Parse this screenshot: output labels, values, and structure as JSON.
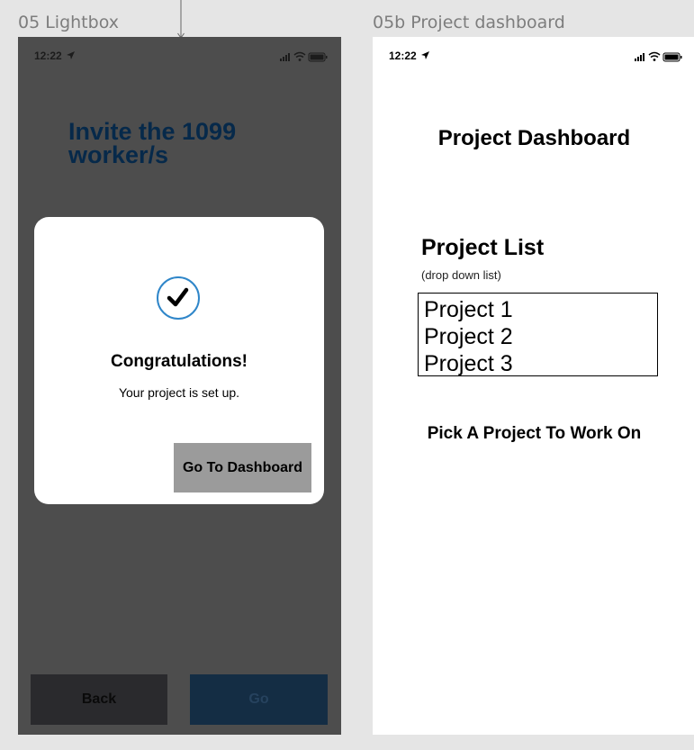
{
  "frames": {
    "lightbox_title": "05 Lightbox",
    "dashboard_title": "05b Project dashboard"
  },
  "status_bar": {
    "time": "12:22"
  },
  "lightbox": {
    "background_heading": "Invite the 1099 worker/s",
    "modal": {
      "title": "Congratulations!",
      "message": "Your project is set up.",
      "button_label": "Go To Dashboard"
    },
    "back_label": "Back",
    "go_label": "Go"
  },
  "dashboard": {
    "title": "Project Dashboard",
    "list_title": "Project List",
    "list_hint": "(drop down list)",
    "projects": [
      "Project 1",
      "Project 2",
      "Project 3"
    ],
    "pick_label": "Pick A Project To Work On"
  },
  "colors": {
    "overlay": "#4d4d4d",
    "heading_navy": "#06294a",
    "check_blue": "#2f86c9",
    "modal_button": "#9b9b9b",
    "go_button": "#142d44"
  },
  "icons": [
    "location-arrow-icon",
    "signal-icon",
    "wifi-icon",
    "battery-icon",
    "checkmark-icon"
  ]
}
